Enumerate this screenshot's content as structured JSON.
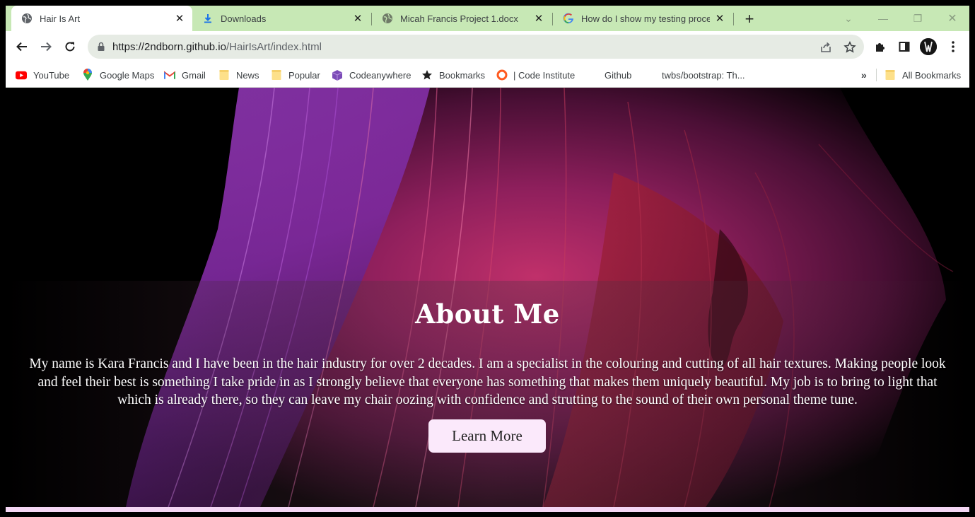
{
  "browser": {
    "tabs": [
      {
        "title": "Hair Is Art",
        "icon": "globe-icon",
        "active": true
      },
      {
        "title": "Downloads",
        "icon": "download-icon",
        "active": false
      },
      {
        "title": "Micah Francis Project 1.docx",
        "icon": "globe-icon",
        "active": false
      },
      {
        "title": "How do I show my testing proce",
        "icon": "google-icon",
        "active": false
      }
    ],
    "url_host": "https://2ndborn.github.io",
    "url_path": "/HairIsArt/index.html",
    "accent_color": "#c7e8b5"
  },
  "bookmarks": {
    "items": [
      {
        "label": "YouTube",
        "icon": "youtube-icon"
      },
      {
        "label": "Google Maps",
        "icon": "maps-pin-icon"
      },
      {
        "label": "Gmail",
        "icon": "gmail-icon"
      },
      {
        "label": "News",
        "icon": "folder-icon"
      },
      {
        "label": "Popular",
        "icon": "folder-icon"
      },
      {
        "label": "Codeanywhere",
        "icon": "cube-icon"
      },
      {
        "label": "Bookmarks",
        "icon": "star-icon"
      },
      {
        "label": "| Code Institute",
        "icon": "ring-icon"
      },
      {
        "label": "Github",
        "icon": ""
      },
      {
        "label": "twbs/bootstrap: Th...",
        "icon": ""
      }
    ],
    "overflow": "»",
    "all_bookmarks": "All Bookmarks"
  },
  "page": {
    "heading": "About Me",
    "body": "My name is Kara Francis and I have been in the hair industry for over 2 decades. I am a specialist in the colouring and cutting of all hair textures. Making people look and feel their best is something I take pride in as I strongly believe that everyone has something that makes them uniquely beautiful. My job is to bring to light that which is already there, so they can leave my chair oozing with confidence and strutting to the sound of their own personal theme tune.",
    "button": "Learn More",
    "button_color": "#fbe9fb",
    "footer_color": "#f5d7f5"
  }
}
